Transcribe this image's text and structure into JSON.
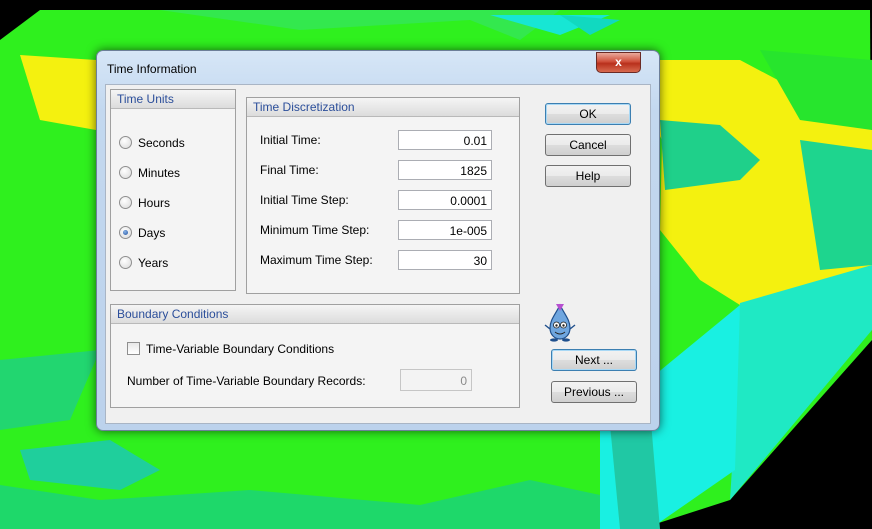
{
  "dialog": {
    "title": "Time Information",
    "close_glyph": "x"
  },
  "time_units": {
    "heading": "Time Units",
    "options": [
      "Seconds",
      "Minutes",
      "Hours",
      "Days",
      "Years"
    ],
    "selected": "Days"
  },
  "discretization": {
    "heading": "Time Discretization",
    "fields": [
      {
        "label": "Initial Time:",
        "value": "0.01"
      },
      {
        "label": "Final Time:",
        "value": "1825"
      },
      {
        "label": "Initial Time Step:",
        "value": "0.0001"
      },
      {
        "label": "Minimum Time Step:",
        "value": "1e-005"
      },
      {
        "label": "Maximum Time Step:",
        "value": "30"
      }
    ]
  },
  "boundary": {
    "heading": "Boundary Conditions",
    "checkbox_label": "Time-Variable Boundary Conditions",
    "checked": false,
    "records_label": "Number of Time-Variable Boundary Records:",
    "records_value": "0"
  },
  "buttons": {
    "ok": "OK",
    "cancel": "Cancel",
    "help": "Help",
    "next": "Next ...",
    "previous": "Previous ..."
  },
  "colors": {
    "terrain_green": "#33ee22",
    "terrain_yellow": "#f2f21a",
    "terrain_cyan": "#19f0c8",
    "terrain_teal": "#1fc79c",
    "radio_selected": "#1e4f9e"
  },
  "icons": {
    "mascot": "drop-mascot-icon"
  }
}
